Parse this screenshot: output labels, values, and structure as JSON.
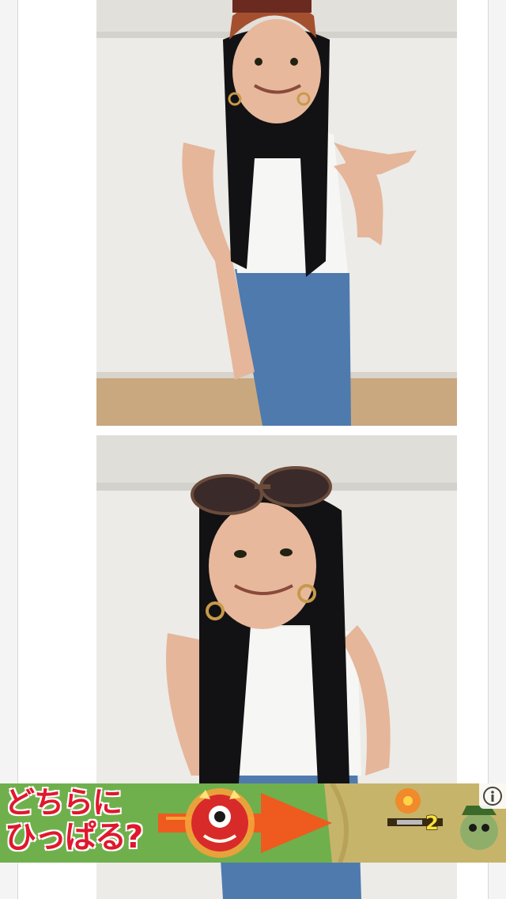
{
  "ad": {
    "headline_line1": "どちらに",
    "headline_line2": "ひっぱる?",
    "counter_value": "2",
    "info_icon": "info-icon"
  },
  "photos": [
    {
      "subject": "person-with-cap-and-long-black-wig"
    },
    {
      "subject": "person-with-sunglasses-on-head-and-long-black-wig"
    }
  ],
  "colors": {
    "ad_headline": "#e0182d",
    "ad_background": "#5da53e",
    "ad_arrow": "#ef5a1e",
    "ad_sand": "#c8b46a"
  }
}
